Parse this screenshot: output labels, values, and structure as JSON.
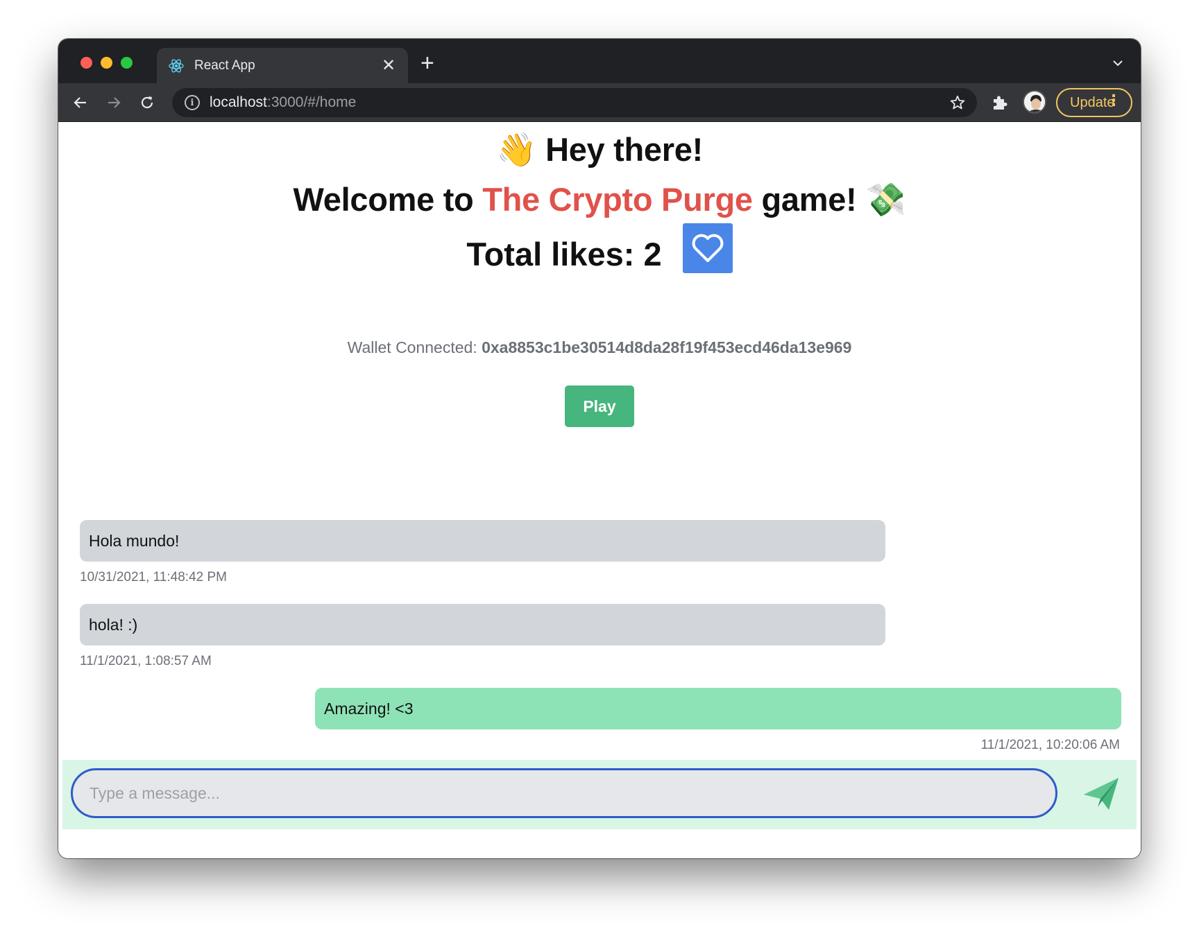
{
  "browser": {
    "tab_title": "React App",
    "tab_close": "✕",
    "new_tab": "+",
    "url_host": "localhost",
    "url_rest": ":3000/#/home",
    "update_label": "Update",
    "update_dots": "⋮"
  },
  "header": {
    "greeting_emoji": "👋",
    "greeting": "Hey there!",
    "welcome_prefix": "Welcome to ",
    "brand": "The Crypto Purge",
    "welcome_suffix": " game!",
    "money_emoji": "💸",
    "likes_text": "Total likes: 2"
  },
  "wallet": {
    "label": "Wallet Connected: ",
    "address": "0xa8853c1be30514d8da28f19f453ecd46da13e969"
  },
  "play_label": "Play",
  "messages": [
    {
      "text": "Hola mundo!",
      "timestamp": "10/31/2021, 11:48:42 PM",
      "side": "incoming"
    },
    {
      "text": "hola! :)",
      "timestamp": "11/1/2021, 1:08:57 AM",
      "side": "incoming"
    },
    {
      "text": "Amazing! <3",
      "timestamp": "11/1/2021, 10:20:06 AM",
      "side": "outgoing"
    }
  ],
  "composer": {
    "placeholder": "Type a message..."
  },
  "colors": {
    "brand_red": "#e0524a",
    "like_blue": "#4a86e8",
    "play_green": "#47b57e",
    "outgoing_bubble": "#8de3b6",
    "incoming_bubble": "#d2d5da"
  },
  "icons": [
    "react-logo-icon",
    "back-arrow-icon",
    "forward-arrow-icon",
    "reload-icon",
    "info-icon",
    "star-icon",
    "puzzle-extension-icon",
    "heart-icon",
    "send-paper-plane-icon",
    "chevron-down-icon"
  ]
}
